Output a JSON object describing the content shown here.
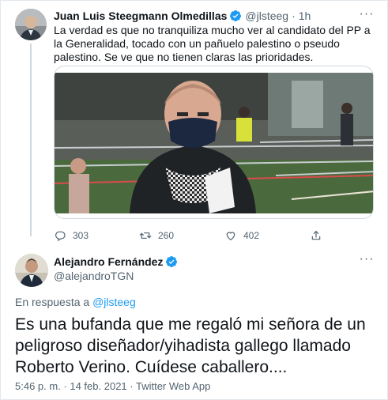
{
  "parent_tweet": {
    "author_name": "Juan Luis Steegmann Olmedillas",
    "handle": "@jlsteeg",
    "separator": "·",
    "time": "1h",
    "text": "La verdad es que no tranquiliza mucho ver al candidato del PP a la Generalidad, tocado con un pañuelo palestino o pseudo palestino. Se ve que no tienen claras las prioridades.",
    "media_type": "video",
    "video_progress_percent": 0,
    "actions": {
      "replies": "303",
      "retweets": "260",
      "likes": "402"
    }
  },
  "main_tweet": {
    "author_name": "Alejandro Fernández",
    "handle": "@alejandroTGN",
    "reply_prefix": "En respuesta a",
    "reply_handle": "@jlsteeg",
    "text": "Es una bufanda que me regaló mi señora de un peligroso diseñador/yihadista gallego llamado Roberto Verino. Cuídese caballero....",
    "timestamp": "5:46 p. m. · 14 feb. 2021 · Twitter Web App"
  },
  "colors": {
    "accent": "#1d9bf0",
    "secondary_text": "#536471",
    "primary_text": "#0f1419",
    "verified": "#1d9bf0"
  },
  "icons": [
    "more-icon",
    "verified-badge-icon",
    "reply-icon",
    "retweet-icon",
    "like-icon",
    "share-icon"
  ]
}
